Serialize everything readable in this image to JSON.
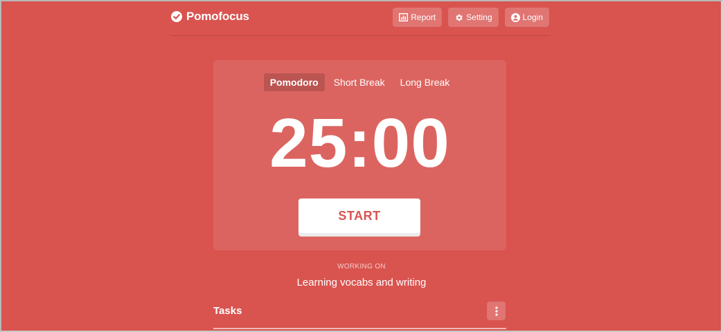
{
  "colors": {
    "background": "#d9534f",
    "start_text": "#d9534f",
    "text": "#ffffff"
  },
  "header": {
    "brand": "Pomofocus",
    "brand_icon": "check-circle-icon",
    "nav": [
      {
        "label": "Report",
        "icon": "chart-icon"
      },
      {
        "label": "Setting",
        "icon": "gear-icon"
      },
      {
        "label": "Login",
        "icon": "user-circle-icon"
      }
    ]
  },
  "timer": {
    "modes": [
      {
        "label": "Pomodoro",
        "active": true
      },
      {
        "label": "Short Break",
        "active": false
      },
      {
        "label": "Long Break",
        "active": false
      }
    ],
    "time": "25:00",
    "start_label": "START"
  },
  "working": {
    "label": "WORKING ON",
    "task": "Learning vocabs and writing"
  },
  "tasks": {
    "title": "Tasks",
    "menu_icon": "more-vertical-icon"
  }
}
